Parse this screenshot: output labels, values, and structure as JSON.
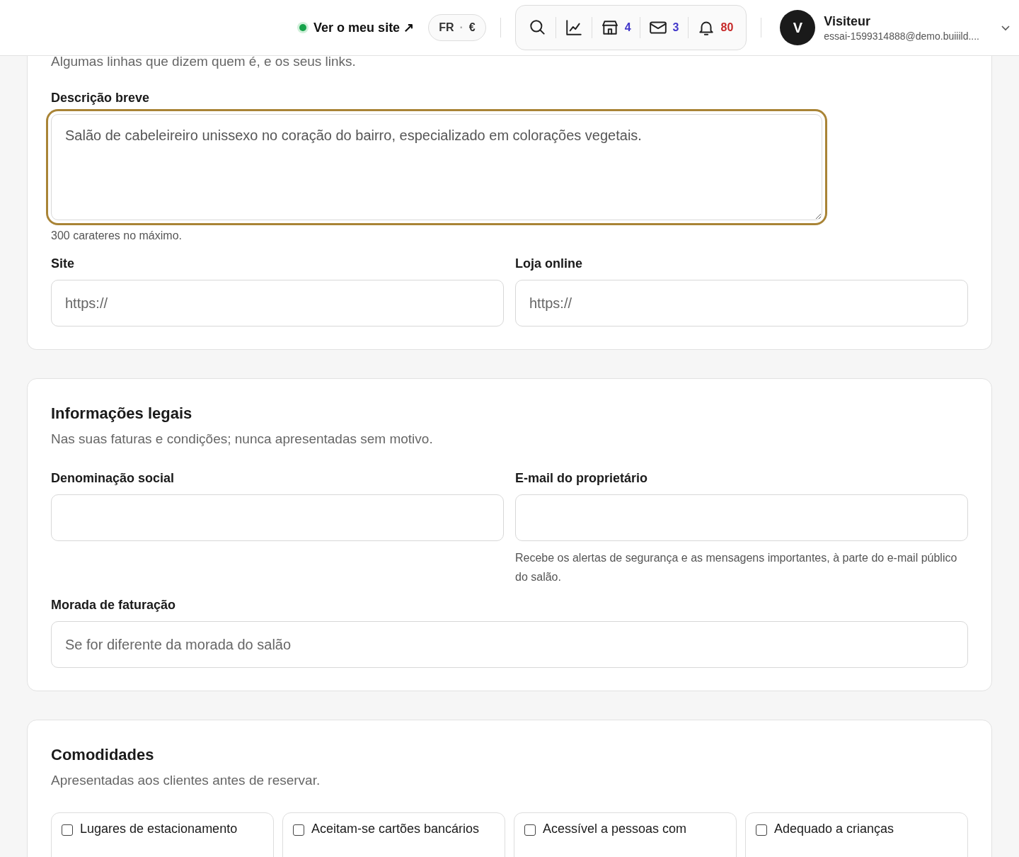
{
  "header": {
    "site_link": {
      "label": "Ver o meu site ↗",
      "online": true
    },
    "locale": {
      "language": "FR",
      "separator": "·",
      "currency": "€"
    },
    "toolbar": [
      {
        "kind": "search"
      },
      {
        "kind": "stats"
      },
      {
        "kind": "shop",
        "count": "4",
        "color": "#4338ca"
      },
      {
        "kind": "mail",
        "count": "3",
        "color": "#4338ca"
      },
      {
        "kind": "bell",
        "count": "80",
        "color": "#c62828"
      }
    ],
    "user": {
      "initial": "V",
      "name": "Visiteur",
      "email": "essai-1599314888@demo.buiiild...."
    }
  },
  "sections": [
    {
      "subtitle": "Algumas linhas que dizem quem é, e os seus links.",
      "fields": [
        {
          "kind": "textarea",
          "label": "Descrição breve",
          "value": "Salão de cabeleireiro unissexo no coração do bairro, especializado em colorações vegetais.",
          "focused": true,
          "hint": "300 carateres no máximo."
        },
        {
          "kind": "input",
          "label": "Site",
          "placeholder": "https://"
        },
        {
          "kind": "input",
          "label": "Loja online",
          "placeholder": "https://"
        }
      ]
    },
    {
      "title": "Informações legais",
      "subtitle": "Nas suas faturas e condições; nunca apresentadas sem motivo.",
      "fields": [
        {
          "kind": "input",
          "label": "Denominação social"
        },
        {
          "kind": "input",
          "label": "E-mail do proprietário",
          "hint": "Recebe os alertas de segurança e as mensagens importantes, à parte do e-mail público do salão."
        },
        {
          "kind": "wide_input",
          "label": "Morada de faturação",
          "placeholder": "Se for diferente da morada do salão"
        }
      ]
    },
    {
      "title": "Comodidades",
      "subtitle": "Apresentadas aos clientes antes de reservar.",
      "amenities": [
        {
          "label": "Lugares de estacionamento",
          "checked": false
        },
        {
          "label": "Aceitam-se cartões bancários",
          "checked": false
        },
        {
          "label": "Acessível a pessoas com",
          "checked": false
        },
        {
          "label": "Adequado a crianças",
          "checked": false
        }
      ]
    }
  ]
}
